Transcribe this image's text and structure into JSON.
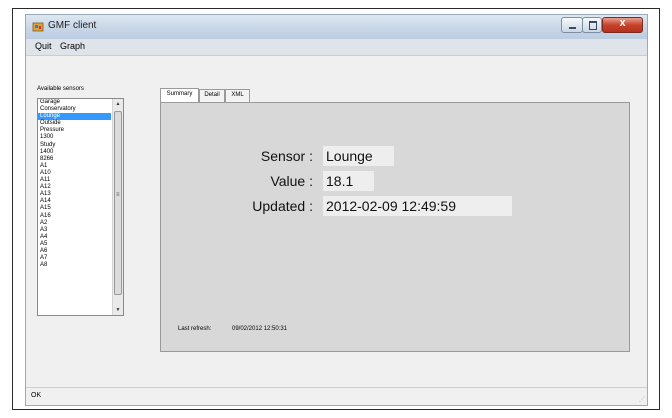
{
  "window": {
    "title": "GMF client",
    "close_glyph": "x",
    "app_icon": "gmf-app-icon",
    "controls": [
      "minimize-icon",
      "maximize-icon",
      "close-icon"
    ]
  },
  "menu": {
    "quit": "Quit",
    "graph": "Graph"
  },
  "sensors": {
    "label": "Available sensors",
    "items": [
      "Garage",
      "Conservatory",
      "Lounge",
      "Outside",
      "Pressure",
      "1300",
      "Study",
      "1400",
      "8266",
      "A1",
      "A10",
      "A11",
      "A12",
      "A13",
      "A14",
      "A15",
      "A16",
      "A2",
      "A3",
      "A4",
      "A5",
      "A6",
      "A7",
      "A8"
    ],
    "selected": "Lounge",
    "scroll_up": "▲",
    "scroll_down": "▼",
    "thumb_grip": "≡"
  },
  "tabs": [
    {
      "label": "Summary",
      "active": true
    },
    {
      "label": "Detail",
      "active": false
    },
    {
      "label": "XML",
      "active": false
    }
  ],
  "summary": {
    "sensor_label": "Sensor :",
    "sensor_value": "Lounge",
    "value_label": "Value :",
    "value_value": "18.1",
    "updated_label": "Updated :",
    "updated_value": "2012-02-09 12:49:59",
    "last_refresh_label": "Last refresh:",
    "last_refresh_value": "09/02/2012 12:50:31"
  },
  "status": {
    "text": "OK",
    "grip": "⋰"
  },
  "colors": {
    "selection": "#3399ff",
    "panel": "#d8d8d8",
    "close_button": "#c7422c"
  }
}
